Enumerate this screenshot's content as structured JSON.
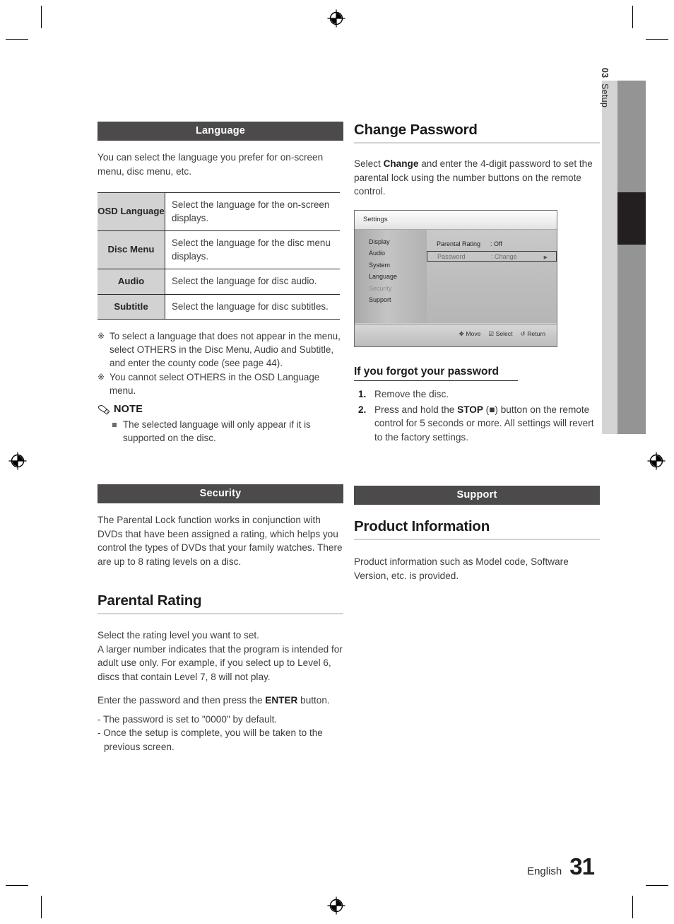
{
  "page": {
    "chapter_number": "03",
    "chapter_name": "Setup",
    "footer_language": "English",
    "footer_page_number": "31"
  },
  "left_column": {
    "language_section": {
      "header": "Language",
      "intro": "You can select the language you prefer for on-screen menu, disc menu, etc.",
      "table": {
        "rows": [
          {
            "key": "OSD Language",
            "value": "Select the language for the on-screen displays."
          },
          {
            "key": "Disc Menu",
            "value": "Select the language for the disc menu displays."
          },
          {
            "key": "Audio",
            "value": "Select the language for disc audio."
          },
          {
            "key": "Subtitle",
            "value": "Select the language for disc subtitles."
          }
        ]
      },
      "star_notes": [
        "To select a language that does not appear in the menu, select OTHERS in the Disc Menu, Audio and Subtitle, and enter the county code (see page 44).",
        "You cannot select OTHERS in the OSD Language menu."
      ],
      "note_label": "NOTE",
      "note_items": [
        "The selected language will only appear if it is supported on the disc."
      ]
    },
    "security_section": {
      "header": "Security",
      "intro": "The Parental Lock function works in conjunction with DVDs that have been assigned a rating, which helps you control the types of DVDs that your family watches. There are up to 8 rating levels on a disc.",
      "heading": "Parental Rating",
      "paragraph_1_line_1": "Select the rating level you want to set.",
      "paragraph_1_line_2": "A larger number indicates that the program is intended for adult use only. For example, if you select up to Level 6, discs that contain Level 7, 8 will not play.",
      "paragraph_2_pre": "Enter the password and then press the ",
      "paragraph_2_bold": "ENTER",
      "paragraph_2_post": " button.",
      "dash_items": [
        "- The password is set to \"0000\" by default.",
        "- Once the setup is complete, you will be taken to the previous screen."
      ]
    }
  },
  "right_column": {
    "change_password_section": {
      "heading": "Change Password",
      "paragraph_pre": "Select ",
      "paragraph_bold": "Change",
      "paragraph_post": " and enter the 4-digit password to set the parental lock using the number buttons on the remote control."
    },
    "osd_screenshot": {
      "title": "Settings",
      "nav_items": [
        {
          "label": "Display",
          "dimmed": false
        },
        {
          "label": "Audio",
          "dimmed": false
        },
        {
          "label": "System",
          "dimmed": false
        },
        {
          "label": "Language",
          "dimmed": false
        },
        {
          "label": "Security",
          "dimmed": true
        },
        {
          "label": "Support",
          "dimmed": false
        }
      ],
      "rows": [
        {
          "label": "Parental Rating",
          "value": ": Off",
          "selected": false,
          "arrow": ""
        },
        {
          "label": "Password",
          "value": ": Change",
          "selected": true,
          "arrow": "▶"
        }
      ],
      "hints": [
        {
          "icon": "✥",
          "label": "Move"
        },
        {
          "icon": "☑",
          "label": "Select"
        },
        {
          "icon": "↺",
          "label": "Return"
        }
      ]
    },
    "forgot_password_section": {
      "heading": "If you forgot your password",
      "steps": [
        {
          "num": "1.",
          "pre": "Remove the disc.",
          "bold": "",
          "post": ""
        },
        {
          "num": "2.",
          "pre": "Press and hold the ",
          "bold": "STOP",
          "post": " (■) button on the remote control for 5 seconds or more. All settings will revert to the factory settings."
        }
      ]
    },
    "support_section": {
      "header": "Support",
      "heading": "Product Information",
      "paragraph": "Product information such as Model code, Software Version, etc. is provided."
    }
  }
}
